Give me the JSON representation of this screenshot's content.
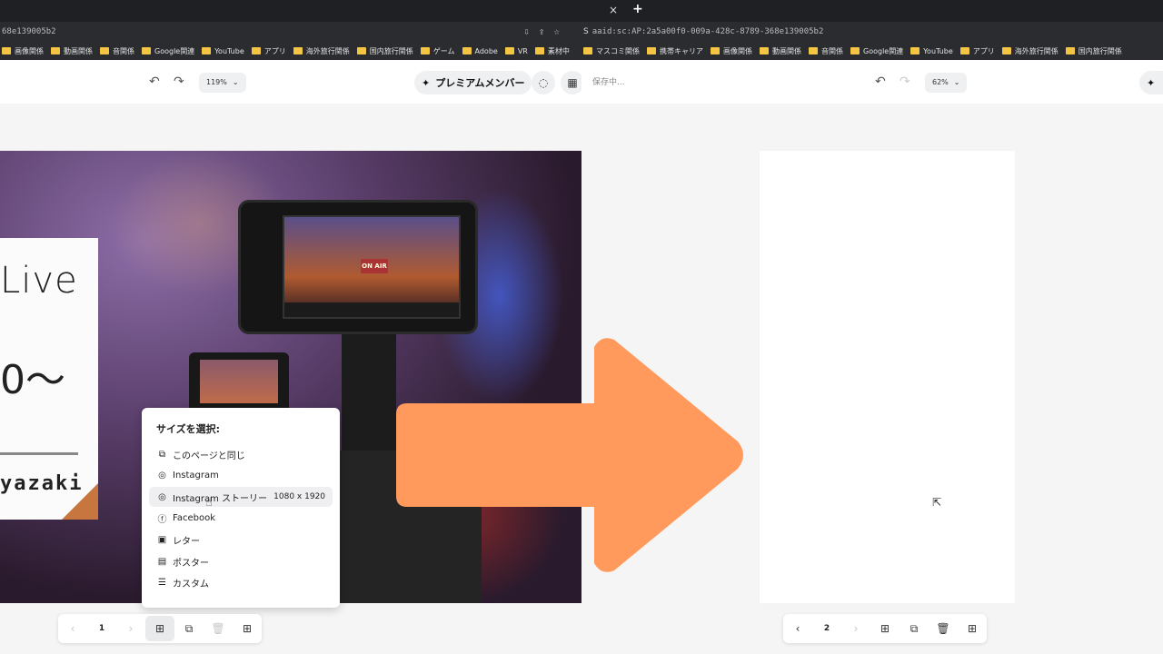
{
  "left": {
    "omnibox_text": "68e139005b2",
    "bookmarks": [
      "画像関係",
      "動画関係",
      "音関係",
      "Google関連",
      "YouTube",
      "アプリ",
      "海外旅行関係",
      "国内旅行関係",
      "ゲーム",
      "Adobe",
      "VR",
      "素材中"
    ],
    "toolbar": {
      "zoom": "119%",
      "premium_label": "プレミアムメンバー"
    },
    "card": {
      "live_text": "Live",
      "tilde_text": "0〜",
      "name_text": "yazaki"
    },
    "photo": {
      "onair_text": "ON AIR"
    },
    "size_menu": {
      "title": "サイズを選択:",
      "items": [
        {
          "label": "このページと同じ",
          "icon": "copy-page-icon",
          "size": ""
        },
        {
          "label": "Instagram",
          "icon": "instagram-icon",
          "size": ""
        },
        {
          "label": "Instagram ストーリー",
          "icon": "instagram-icon",
          "size": "1080 x 1920"
        },
        {
          "label": "Facebook",
          "icon": "facebook-icon",
          "size": ""
        },
        {
          "label": "レター",
          "icon": "letter-icon",
          "size": ""
        },
        {
          "label": "ポスター",
          "icon": "poster-icon",
          "size": ""
        },
        {
          "label": "カスタム",
          "icon": "custom-sliders-icon",
          "size": ""
        }
      ]
    },
    "pagebar": {
      "page_number": "1"
    }
  },
  "right": {
    "tab_close": "×",
    "tab_new": "+",
    "omnibox_site": "S",
    "omnibox_text": "aaid:sc:AP:2a5a00f0-009a-428c-8789-368e139005b2",
    "bookmarks": [
      "マスコミ関係",
      "携帯キャリア",
      "画像関係",
      "動画関係",
      "音関係",
      "Google関連",
      "YouTube",
      "アプリ",
      "海外旅行関係",
      "国内旅行関係"
    ],
    "toolbar": {
      "saving_text": "保存中...",
      "zoom": "62%"
    },
    "pagebar": {
      "page_number": "2"
    }
  },
  "colors": {
    "arrow": "#ff9a5c",
    "chrome_dark": "#1f2023",
    "chrome_mid": "#2b2c2f",
    "canvas_bg": "#f5f5f6",
    "folder": "#f4c542",
    "card_corner": "#c7763f"
  }
}
